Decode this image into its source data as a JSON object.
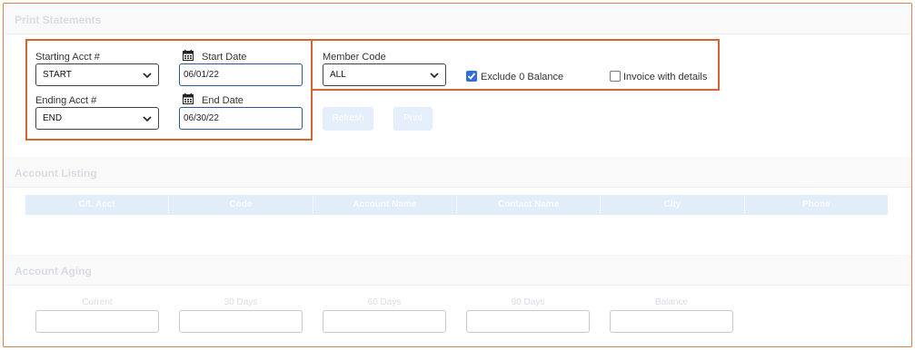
{
  "print_statements": {
    "title": "Print Statements",
    "starting_acct": {
      "label": "Starting Acct #",
      "value": "START"
    },
    "ending_acct": {
      "label": "Ending Acct #",
      "value": "END"
    },
    "start_date": {
      "label": "Start Date",
      "value": "06/01/22"
    },
    "end_date": {
      "label": "End Date",
      "value": "06/30/22"
    },
    "member_code": {
      "label": "Member Code",
      "value": "ALL"
    },
    "exclude_zero": {
      "label": "Exclude 0 Balance",
      "checked": true
    },
    "invoice_details": {
      "label": "Invoice with details",
      "checked": false
    },
    "refresh_label": "Refresh",
    "print_label": "Print"
  },
  "account_listing": {
    "title": "Account Listing",
    "columns": [
      "C/L Acct",
      "Code",
      "Account Name",
      "Contact Name",
      "City",
      "Phone"
    ]
  },
  "account_aging": {
    "title": "Account Aging",
    "fields": [
      "Current",
      "30 Days",
      "60 Days",
      "90 Days",
      "Balance"
    ]
  },
  "colors": {
    "highlight_border": "#d2662e",
    "frame_border": "#d9824a",
    "checkbox_accent": "#2f6fd6",
    "table_header_bg": "#e2edfa"
  }
}
